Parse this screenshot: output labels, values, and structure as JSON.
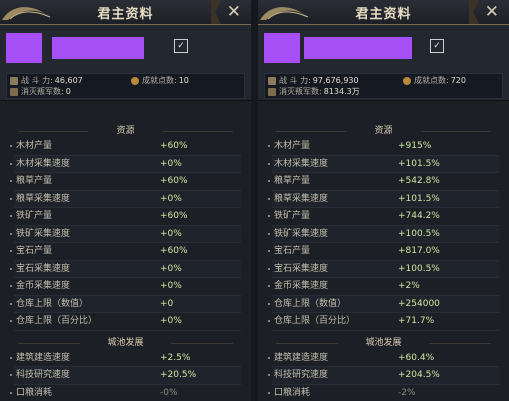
{
  "left": {
    "title": "君主资料",
    "stats": {
      "power_label": "战 斗 力:",
      "power_value": "46,607",
      "rank_label": "成就点数:",
      "rank_value": "10",
      "kill_label": "消灭叛军数:",
      "kill_value": "0"
    },
    "resources_header": "资源",
    "resources": [
      {
        "label": "木材产量",
        "value": "+60%"
      },
      {
        "label": "木材采集速度",
        "value": "+0%"
      },
      {
        "label": "粮草产量",
        "value": "+60%"
      },
      {
        "label": "粮草采集速度",
        "value": "+0%"
      },
      {
        "label": "铁矿产量",
        "value": "+60%"
      },
      {
        "label": "铁矿采集速度",
        "value": "+0%"
      },
      {
        "label": "宝石产量",
        "value": "+60%"
      },
      {
        "label": "宝石采集速度",
        "value": "+0%"
      },
      {
        "label": "金币采集速度",
        "value": "+0%"
      },
      {
        "label": "仓库上限（数值）",
        "value": "+0"
      },
      {
        "label": "仓库上限（百分比）",
        "value": "+0%"
      }
    ],
    "city_header": "城池发展",
    "city": [
      {
        "label": "建筑建造速度",
        "value": "+2.5%"
      },
      {
        "label": "科技研究速度",
        "value": "+20.5%"
      },
      {
        "label": "口粮消耗",
        "value": "-0%"
      }
    ]
  },
  "right": {
    "title": "君主资料",
    "stats": {
      "power_label": "战 斗 力:",
      "power_value": "97,676,930",
      "rank_label": "成就点数:",
      "rank_value": "720",
      "kill_label": "消灭叛军数:",
      "kill_value": "8134.3万"
    },
    "resources_header": "资源",
    "resources": [
      {
        "label": "木材产量",
        "value": "+915%"
      },
      {
        "label": "木材采集速度",
        "value": "+101.5%"
      },
      {
        "label": "粮草产量",
        "value": "+542.8%"
      },
      {
        "label": "粮草采集速度",
        "value": "+101.5%"
      },
      {
        "label": "铁矿产量",
        "value": "+744.2%"
      },
      {
        "label": "铁矿采集速度",
        "value": "+100.5%"
      },
      {
        "label": "宝石产量",
        "value": "+817.0%"
      },
      {
        "label": "宝石采集速度",
        "value": "+100.5%"
      },
      {
        "label": "金币采集速度",
        "value": "+2%"
      },
      {
        "label": "仓库上限（数值）",
        "value": "+254000"
      },
      {
        "label": "仓库上限（百分比）",
        "value": "+71.7%"
      }
    ],
    "city_header": "城池发展",
    "city": [
      {
        "label": "建筑建造速度",
        "value": "+60.4%"
      },
      {
        "label": "科技研究速度",
        "value": "+204.5%"
      },
      {
        "label": "口粮消耗",
        "value": "-2%"
      }
    ]
  },
  "colors": {
    "redaction": "#a64ff6",
    "value_green": "#cfe79f",
    "gold_trim": "#7b6a49"
  }
}
